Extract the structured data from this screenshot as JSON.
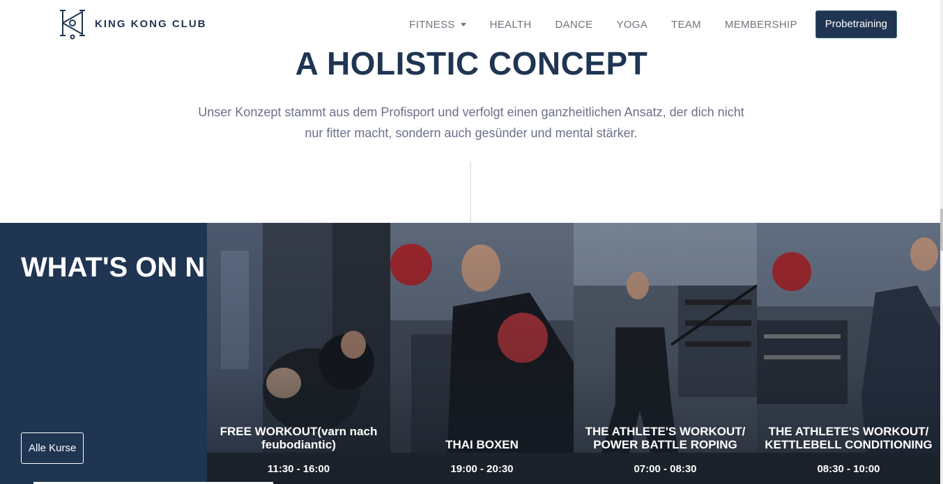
{
  "header": {
    "brand": "KING KONG CLUB",
    "nav": [
      {
        "label": "FITNESS",
        "dropdown": true
      },
      {
        "label": "HEALTH"
      },
      {
        "label": "DANCE"
      },
      {
        "label": "YOGA"
      },
      {
        "label": "TEAM"
      },
      {
        "label": "MEMBERSHIP"
      }
    ],
    "cta": "Probetraining"
  },
  "hero": {
    "title": "A HOLISTIC CONCEPT",
    "text": "Unser Konzept stammt aus dem Profisport und verfolgt einen ganzheitlichen Ansatz, der dich nicht nur fitter macht, sondern auch gesünder und mental stärker."
  },
  "next": {
    "title": "WHAT'S ON NEXT",
    "button": "Alle Kurse",
    "cards": [
      {
        "title": "FREE WORKOUT(varn nach feubodiantic)",
        "time": "11:30 - 16:00",
        "image": "stretching-workout-photo"
      },
      {
        "title": "THAI BOXEN",
        "time": "19:00 - 20:30",
        "image": "boxing-photo"
      },
      {
        "title": "THE ATHLETE'S WORKOUT/ POWER BATTLE ROPING",
        "time": "07:00 - 08:30",
        "image": "battle-rope-photo"
      },
      {
        "title": "THE ATHLETE'S WORKOUT/ KETTLEBELL CONDITIONING",
        "time": "08:30 - 10:00",
        "image": "kettlebell-photo"
      }
    ]
  },
  "colors": {
    "navy": "#1f3552",
    "muted_text": "#6b6f8a",
    "nav_text": "#6c757d"
  }
}
